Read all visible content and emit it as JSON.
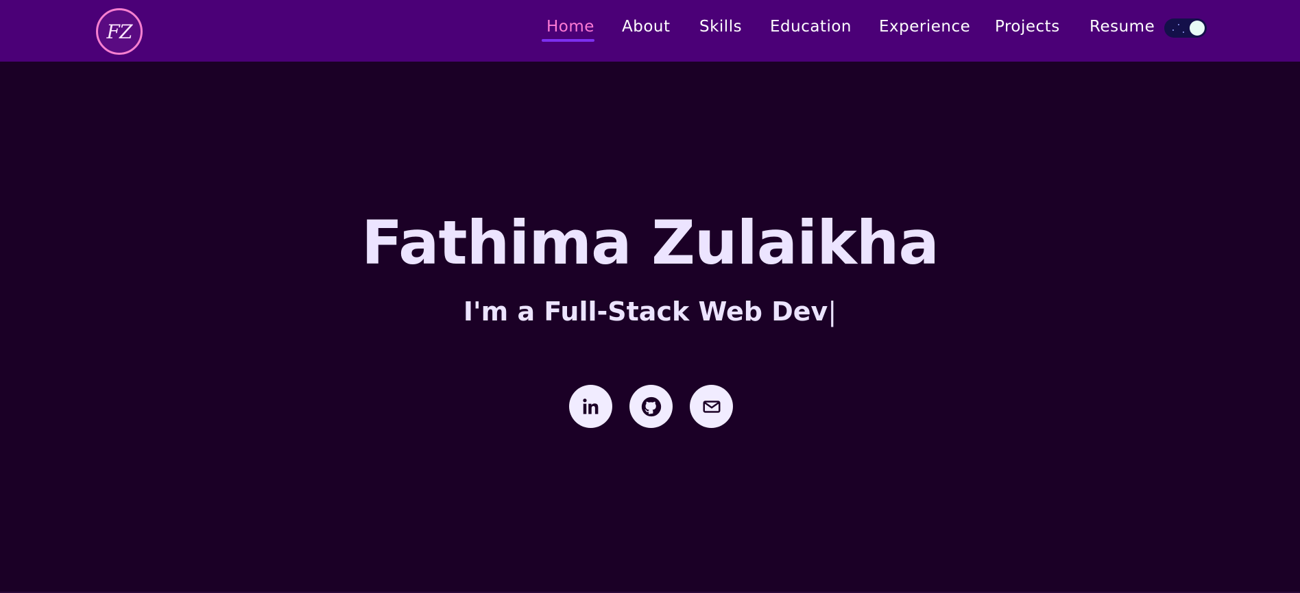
{
  "logo": {
    "text": "FZ"
  },
  "nav": {
    "items": [
      {
        "label": "Home",
        "active": true
      },
      {
        "label": "About",
        "active": false
      },
      {
        "label": "Skills",
        "active": false
      },
      {
        "label": "Education",
        "active": false
      },
      {
        "label": "Experience",
        "active": false
      },
      {
        "label": "Projects",
        "active": false
      },
      {
        "label": "Resume",
        "active": false
      }
    ]
  },
  "theme_toggle": {
    "state": "dark",
    "icon": "moon-toggle-icon"
  },
  "hero": {
    "name": "Fathima Zulaikha",
    "role_prefix": "I'm a ",
    "role_typed": "Full-Stack Web Dev",
    "cursor": "|"
  },
  "socials": [
    {
      "name": "linkedin",
      "icon": "linkedin-icon"
    },
    {
      "name": "github",
      "icon": "github-icon"
    },
    {
      "name": "email",
      "icon": "mail-icon"
    }
  ],
  "colors": {
    "background": "#1b0026",
    "navbar": "#4b0077",
    "accent": "#ff7bd6",
    "underline": "#7c2ff0",
    "text": "#ece4ff"
  }
}
